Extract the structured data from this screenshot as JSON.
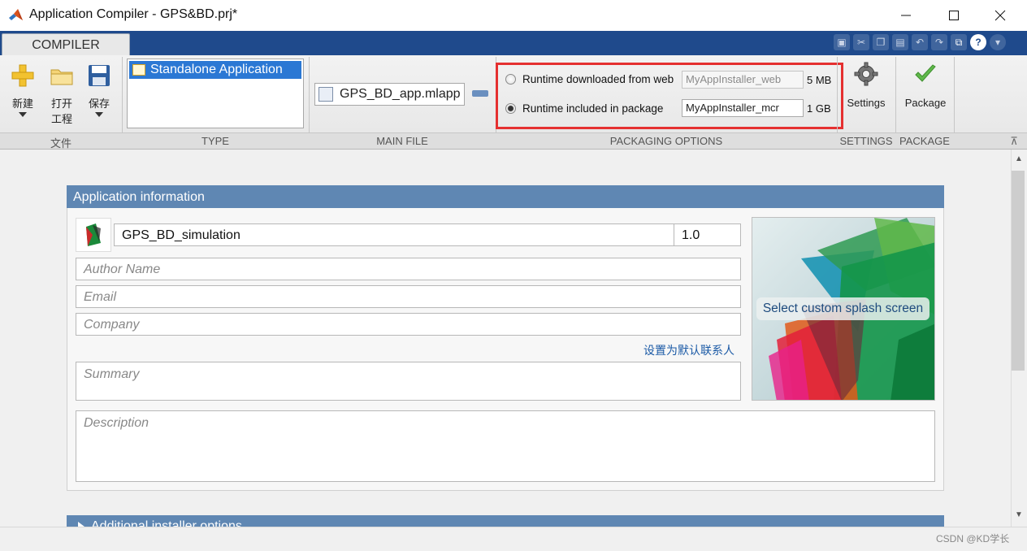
{
  "window": {
    "title": "Application Compiler - GPS&BD.prj*",
    "minimize_icon": "minimize-icon",
    "maximize_icon": "maximize-icon",
    "close_icon": "close-icon"
  },
  "ribbon": {
    "tab": "COMPILER",
    "file_group": {
      "new_label": "新建",
      "open_label_line1": "打开",
      "open_label_line2": "工程",
      "save_label": "保存",
      "group_label": "文件"
    },
    "type_group": {
      "items": [
        "Standalone Application"
      ],
      "group_label": "TYPE"
    },
    "main_file_group": {
      "file": "GPS_BD_app.mlapp",
      "group_label": "MAIN FILE"
    },
    "packaging_group": {
      "option_web_label": "Runtime downloaded from web",
      "option_web_value": "MyAppInstaller_web",
      "option_web_size": "5 MB",
      "option_pkg_label": "Runtime included in package",
      "option_pkg_value": "MyAppInstaller_mcr",
      "option_pkg_size": "1 GB",
      "selected": "Runtime included in package",
      "group_label": "PACKAGING OPTIONS"
    },
    "settings_group": {
      "label": "Settings",
      "group_label": "SETTINGS"
    },
    "package_group": {
      "label": "Package",
      "group_label": "PACKAGE"
    }
  },
  "app_info": {
    "header": "Application information",
    "app_name": "GPS_BD_simulation",
    "version": "1.0",
    "author_placeholder": "Author Name",
    "email_placeholder": "Email",
    "company_placeholder": "Company",
    "set_default_contact": "设置为默认联系人",
    "summary_placeholder": "Summary",
    "description_placeholder": "Description",
    "splash_label": "Select custom splash screen"
  },
  "additional": {
    "header": "Additional installer options"
  },
  "watermark": "CSDN @KD学长",
  "colors": {
    "accent_blue": "#5f87b3",
    "ribbon_blue": "#1f4a8c",
    "highlight_red": "#e53030",
    "selection_blue": "#2b78d4"
  }
}
